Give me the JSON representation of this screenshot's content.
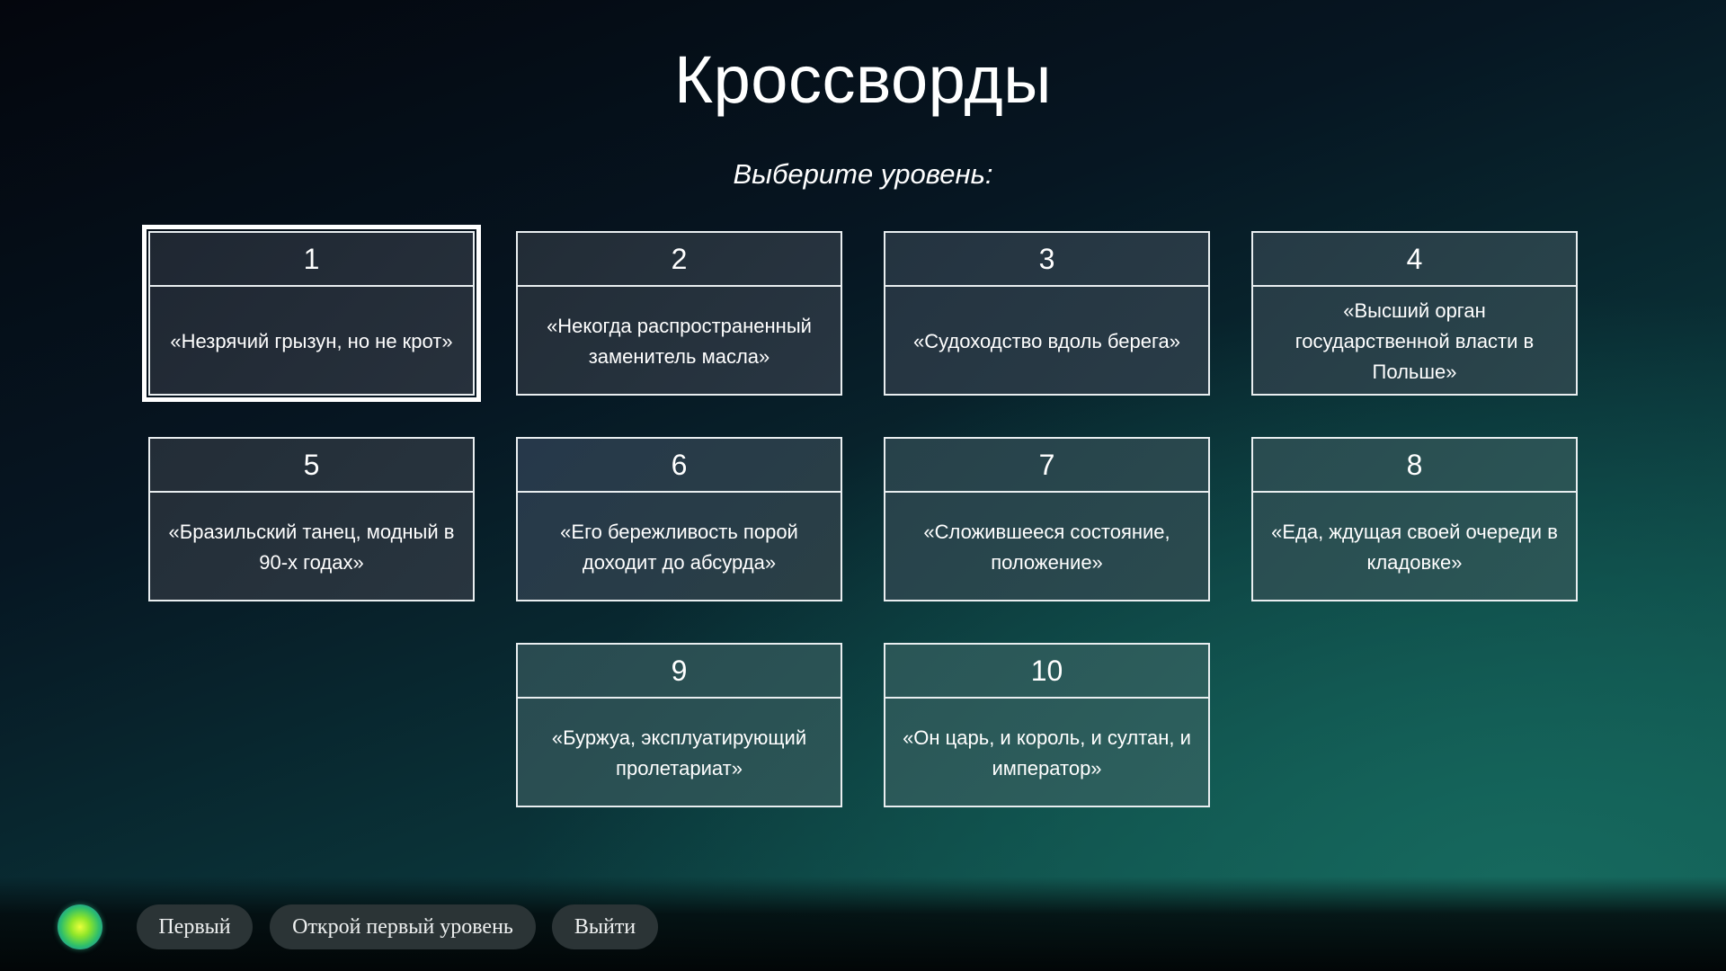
{
  "header": {
    "title": "Кроссворды",
    "subtitle": "Выберите уровень:"
  },
  "levels": [
    {
      "number": "1",
      "clue": "«Незрячий грызун, но не крот»",
      "selected": true
    },
    {
      "number": "2",
      "clue": "«Некогда распространенный заменитель масла»",
      "selected": false
    },
    {
      "number": "3",
      "clue": "«Судоходство вдоль берега»",
      "selected": false
    },
    {
      "number": "4",
      "clue": "«Высший орган государственной власти в Польше»",
      "selected": false
    },
    {
      "number": "5",
      "clue": "«Бразильский танец, модный в 90-х годах»",
      "selected": false
    },
    {
      "number": "6",
      "clue": "«Его бережливость порой доходит до абсурда»",
      "selected": false
    },
    {
      "number": "7",
      "clue": "«Сложившееся состояние, положение»",
      "selected": false
    },
    {
      "number": "8",
      "clue": "«Еда, ждущая своей очереди в кладовке»",
      "selected": false
    },
    {
      "number": "9",
      "clue": "«Буржуа, эксплуатирующий пролетариат»",
      "selected": false
    },
    {
      "number": "10",
      "clue": "«Он царь, и король, и султан, и император»",
      "selected": false
    }
  ],
  "bottom_bar": {
    "assistant_icon": "voice-assistant-orb-icon",
    "buttons": [
      "Первый",
      "Открой первый уровень",
      "Выйти"
    ]
  }
}
